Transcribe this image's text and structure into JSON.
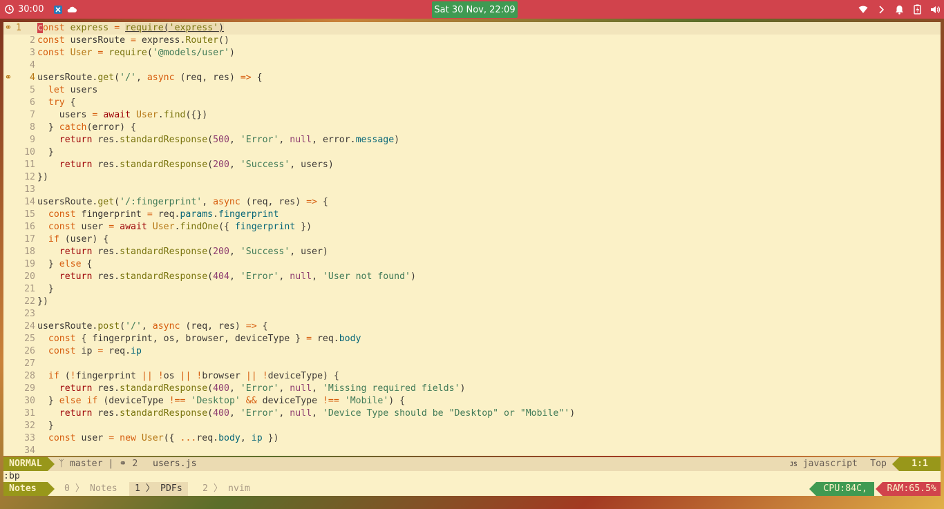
{
  "topbar": {
    "timer": "30:00",
    "clock": "Sat 30 Nov, 22:09"
  },
  "editor": {
    "signs": {
      "1": "💡",
      "4": "💡"
    }
  },
  "statusline": {
    "mode": "NORMAL",
    "branch": "master",
    "separator": "|",
    "hints": "2",
    "filename": "users.js",
    "filetype": "javascript",
    "position": "Top",
    "linecol": "1:1"
  },
  "cmdline": ":bp",
  "tmux": {
    "session": "Notes",
    "windows": [
      {
        "index": "0",
        "name": "Notes"
      },
      {
        "index": "1",
        "name": "PDFs"
      },
      {
        "index": "2",
        "name": "nvim"
      }
    ],
    "cpu": "CPU:84C,",
    "ram": "RAM:65.5%"
  },
  "colors": {
    "accent_red": "#d1434c",
    "accent_green": "#3f9a52",
    "editor_bg": "#fbf1c7",
    "mode_bg": "#98971a"
  }
}
